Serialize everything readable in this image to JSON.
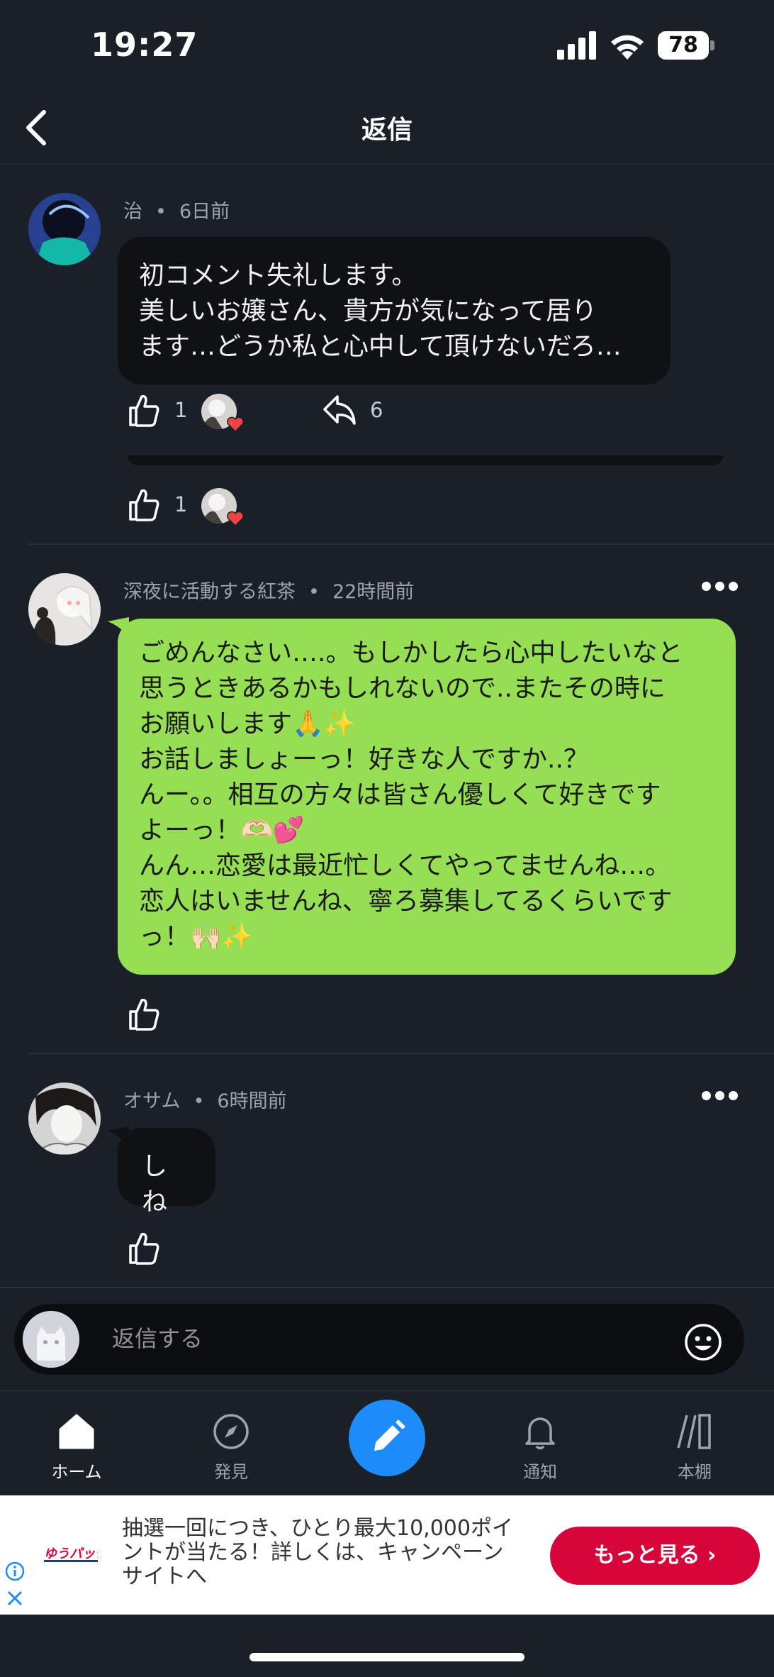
{
  "status": {
    "time": "19:27",
    "battery": "78"
  },
  "header": {
    "title": "返信"
  },
  "comments": [
    {
      "author": "治",
      "time": "6日前",
      "lines": [
        "初コメント失礼します。",
        "美しいお嬢さん、貴方が気になって居り",
        "ます…どうか私と心中して頂けないだろ…"
      ],
      "likes": "1",
      "shares": "6"
    },
    {
      "likes": "1"
    },
    {
      "author": "深夜に活動する紅茶",
      "time": "22時間前",
      "lines": [
        "ごめんなさい….。もしかしたら心中したいなと",
        "思うときあるかもしれないので..またその時に",
        "お願いします🙏✨",
        "お話しましょーっ！好きな人ですか..？",
        "んー。。相互の方々は皆さん優しくて好きです",
        "よーっ！🫶🏻💕",
        "んん…恋愛は最近忙しくてやってませんね…。",
        "恋人はいませんね、寧ろ募集してるくらいです",
        "っ！🙌🏻✨"
      ]
    },
    {
      "author": "オサム",
      "time": "6時間前",
      "lines": [
        "しね"
      ]
    }
  ],
  "composer": {
    "placeholder": "返信する"
  },
  "tabs": [
    {
      "label": "ホーム"
    },
    {
      "label": "発見"
    },
    {
      "label": "通知"
    },
    {
      "label": "本棚"
    }
  ],
  "ad": {
    "logo": "ゆうパック",
    "text": "抽選一回につき、ひとり最大10,000ポイントが当たる！詳しくは、キャンペーンサイトへ",
    "button": "もっと見る"
  },
  "colors": {
    "accent": "#1d8cf8",
    "green_bubble": "#96de54",
    "ad_button": "#d7063a",
    "background": "#1a1f28"
  }
}
